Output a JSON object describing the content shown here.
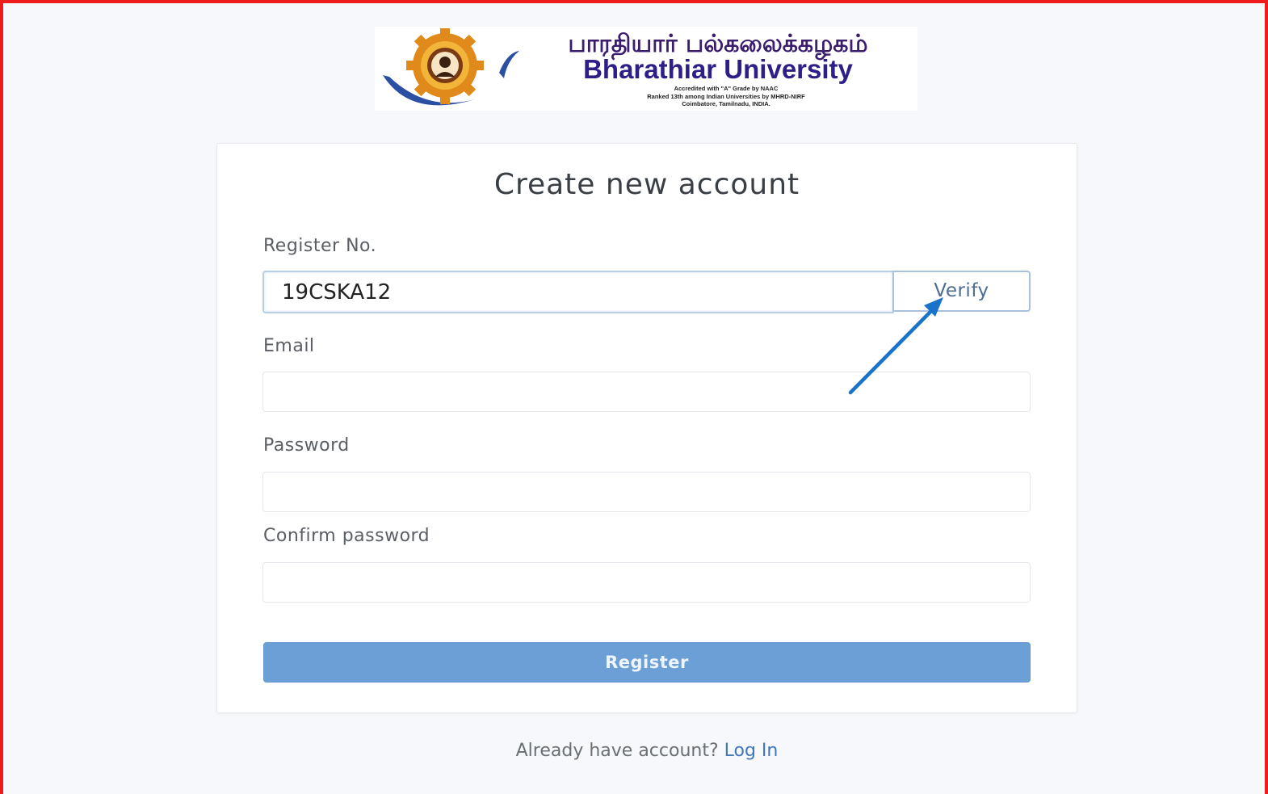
{
  "logo": {
    "tamil_name": "பாரதியார் பல்கலைக்கழகம்",
    "english_name": "Bharathiar University",
    "line1": "Accredited with \"A\" Grade by NAAC",
    "line2": "Ranked 13th among Indian Universities by MHRD-NIRF",
    "line3": "Coimbatore, Tamilnadu, INDIA."
  },
  "form": {
    "title": "Create new account",
    "register_label": "Register No.",
    "register_value": "19CSKA12",
    "verify_label": "Verify",
    "email_label": "Email",
    "email_value": "",
    "password_label": "Password",
    "password_value": "",
    "confirm_label": "Confirm password",
    "confirm_value": "",
    "register_button": "Register"
  },
  "footer": {
    "prompt": "Already have account?",
    "login_link": "Log In"
  },
  "colors": {
    "frame_border": "#ee1c1c",
    "primary_button": "#6c9fd6",
    "link": "#3f77b8",
    "annotation_arrow": "#1a73c8"
  },
  "icons": {
    "logo_emblem": "university-emblem",
    "annotation": "arrow-pointer"
  }
}
